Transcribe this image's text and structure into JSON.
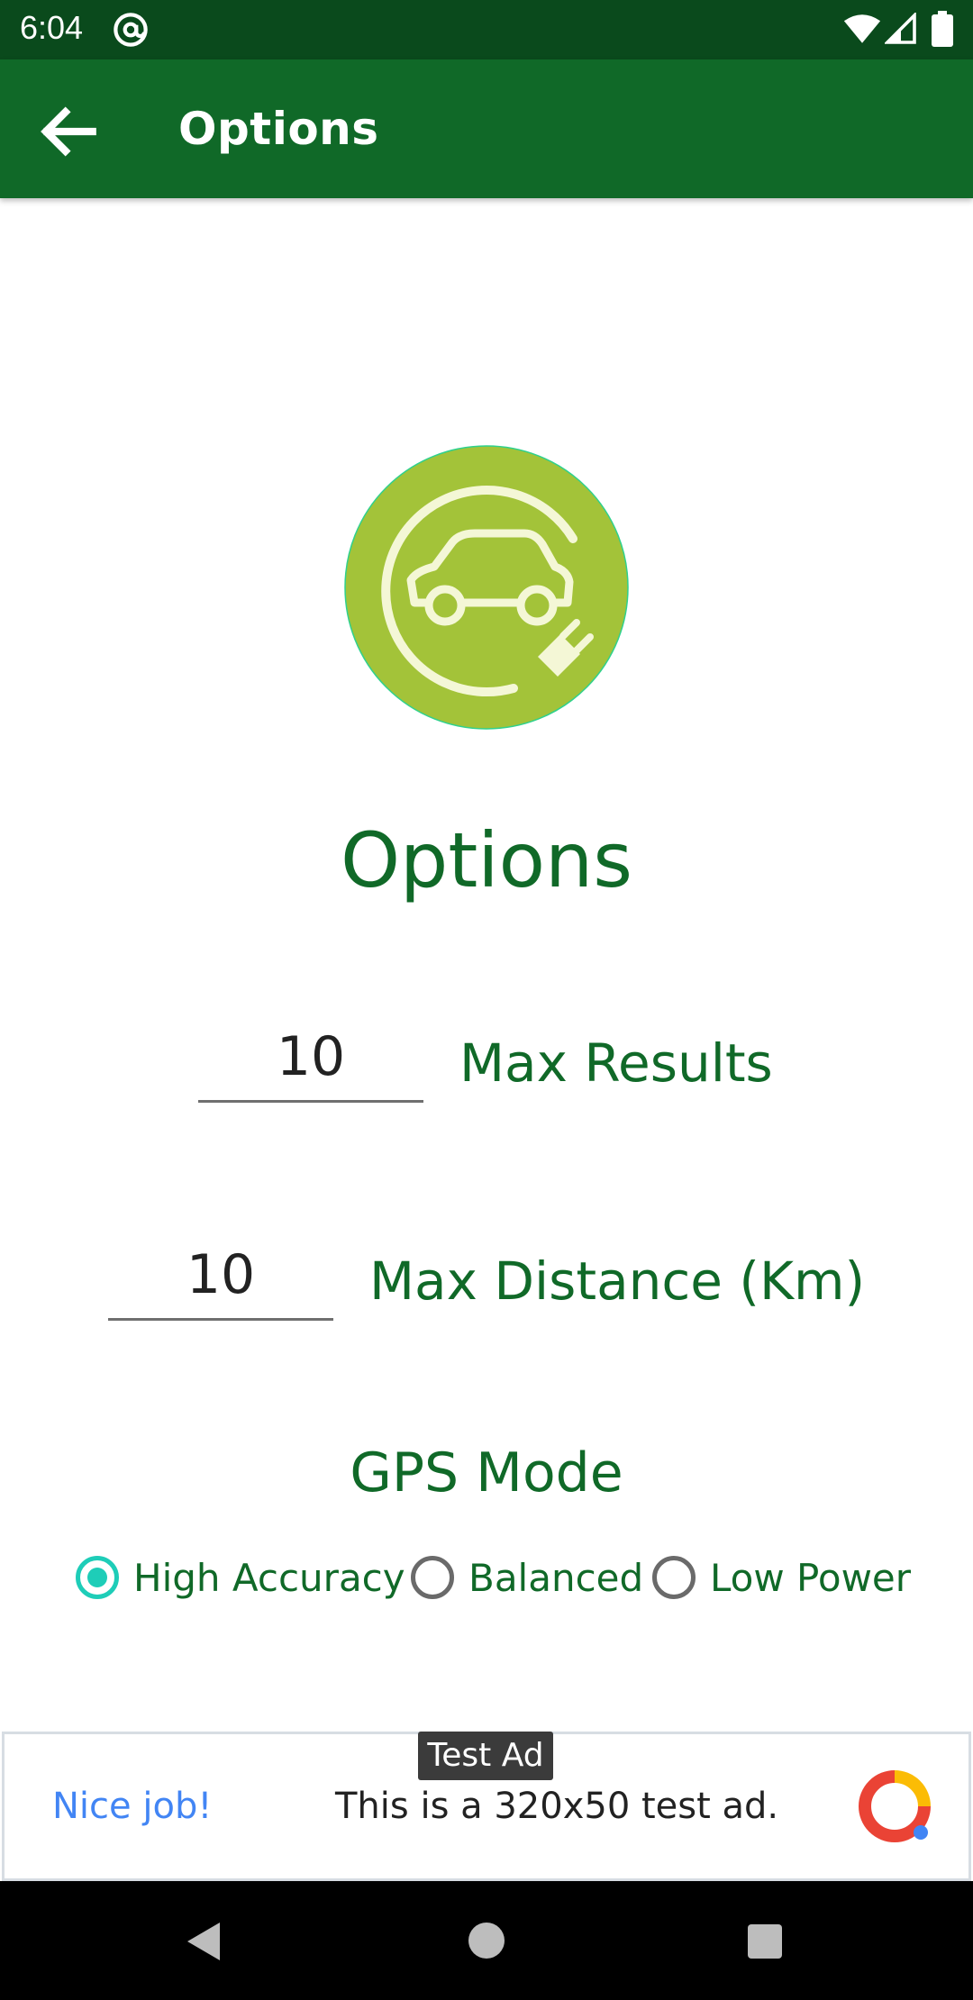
{
  "status_bar": {
    "time": "6:04",
    "icons": [
      "at-sign-icon",
      "wifi-icon",
      "signal-icon",
      "battery-icon"
    ]
  },
  "app_bar": {
    "title": "Options",
    "back_icon": "arrow-back-icon"
  },
  "logo": {
    "icon": "electric-car-plug-icon",
    "color": "#a3c339"
  },
  "heading": "Options",
  "max_results": {
    "value": "10",
    "label": "Max Results"
  },
  "max_distance": {
    "value": "10",
    "label": "Max Distance (Km)"
  },
  "gps": {
    "heading": "GPS Mode",
    "options": [
      {
        "label": "High Accuracy",
        "checked": true
      },
      {
        "label": "Balanced",
        "checked": false
      },
      {
        "label": "Low Power",
        "checked": false
      }
    ]
  },
  "ad": {
    "badge": "Test Ad",
    "nice": "Nice job!",
    "text": "This is a 320x50 test ad."
  },
  "colors": {
    "status_bar": "#0a4a1c",
    "app_bar": "#106928",
    "accent": "#1ecdb8",
    "text_green": "#106928"
  },
  "nav_bar": {
    "icons": [
      "nav-back-icon",
      "nav-home-icon",
      "nav-recents-icon"
    ]
  }
}
